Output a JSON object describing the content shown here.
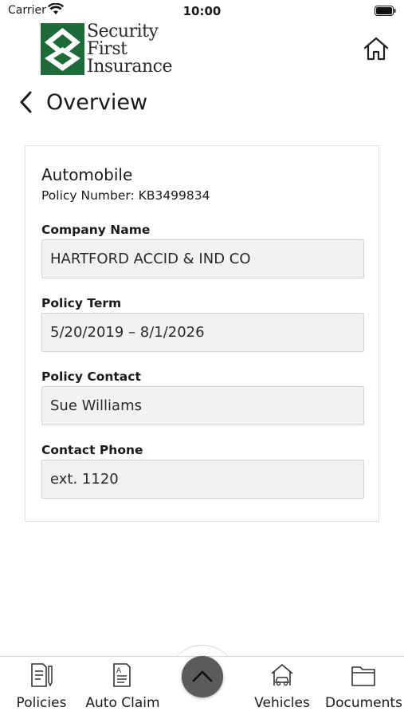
{
  "status_bar": {
    "carrier": "Carrier",
    "time": "10:00"
  },
  "logo": {
    "lines": [
      "Security",
      "First",
      "Insurance"
    ]
  },
  "nav": {
    "back_title": "Overview"
  },
  "policy": {
    "type": "Automobile",
    "number": "Policy Number: KB3499834",
    "fields": [
      {
        "label": "Company Name",
        "value": "HARTFORD ACCID & IND CO"
      },
      {
        "label": "Policy Term",
        "value": "5/20/2019 – 8/1/2026"
      },
      {
        "label": "Policy Contact",
        "value": "Sue Williams"
      },
      {
        "label": "Contact Phone",
        "value": "ext. 1120"
      }
    ]
  },
  "tabs": [
    {
      "label": "Policies",
      "icon": "policy-document-icon"
    },
    {
      "label": "Auto Claim",
      "icon": "auto-claim-icon"
    },
    {
      "label": "Vehicles",
      "icon": "vehicle-house-icon"
    },
    {
      "label": "Documents",
      "icon": "folder-icon"
    }
  ],
  "colors": {
    "brand_green": "#1e6b3a",
    "fab": "#5b5b5b",
    "field_bg": "#f2f2f2"
  }
}
